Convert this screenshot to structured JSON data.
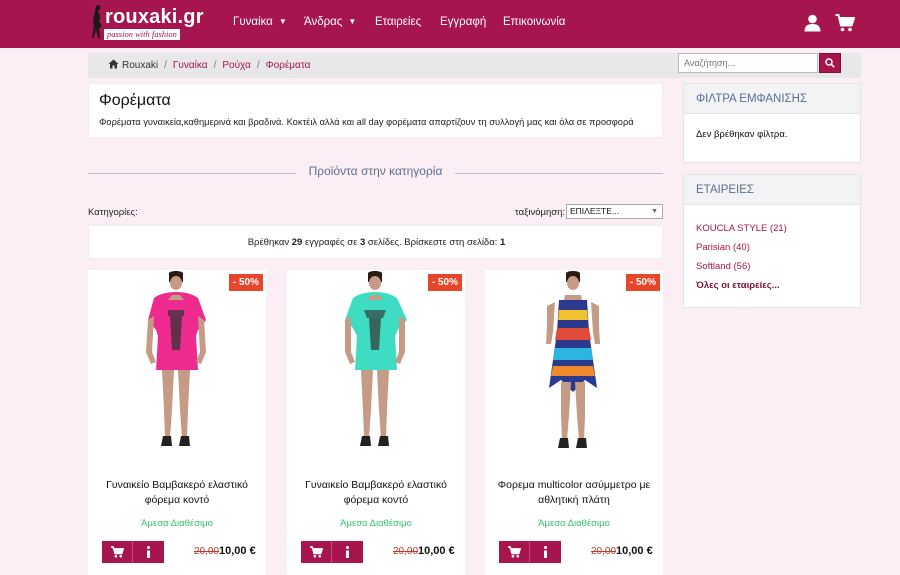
{
  "navbar": {
    "brand": "rouxaki.gr",
    "tagline": "passion with fashion",
    "items": [
      {
        "label": "Γυναίκα",
        "dropdown": true
      },
      {
        "label": "Άνδρας",
        "dropdown": true
      },
      {
        "label": "Εταιρείες",
        "dropdown": false
      },
      {
        "label": "Εγγραφή",
        "dropdown": false
      },
      {
        "label": "Επικοινωνία",
        "dropdown": false
      }
    ],
    "icons": [
      "user-icon",
      "cart-icon"
    ]
  },
  "breadcrumb": {
    "home": "Rouxaki",
    "items": [
      "Γυναίκα",
      "Ρούχα",
      "Φορέματα"
    ]
  },
  "search": {
    "placeholder": "Αναζήτηση..."
  },
  "category": {
    "title": "Φορέματα",
    "description": "Φορέματα γυναικεία,καθημερινά και βραδινά. Κοκτέιλ αλλά και all day φορέματα απαρτίζουν τη συλλογή μας και όλα σε προσφορά"
  },
  "section_title": "Προϊόντα στην κατηγορία",
  "filters": {
    "categories_label": "Κατηγορίες:",
    "sort_label": "ταξινόμηση:",
    "sort_value": "ΕΠΙΛΕΞΤΕ..."
  },
  "results": {
    "prefix": "Βρέθηκαν",
    "count": "29",
    "middle": "εγγραφές σε",
    "pages": "3",
    "suffix": "σελίδες. Βρίσκεστε στη σελίδα:",
    "current": "1"
  },
  "products": [
    {
      "name": "Γυναικείο Βαμβακερό ελαστικό φόρεμα κοντό",
      "badge": "- 50%",
      "availability": "Άμεσα Διαθέσιμο",
      "old_price": "20,00",
      "price": "10,00 €",
      "color": "#ee2a8f"
    },
    {
      "name": "Γυναικείο Βαμβακερό ελαστικό φόρεμα κοντό",
      "badge": "- 50%",
      "availability": "Άμεσα Διαθέσιμο",
      "old_price": "20,00",
      "price": "10,00 €",
      "color": "#3fdcc4"
    },
    {
      "name": "Φορεμα multicolor ασύμμετρο με αθλητική πλάτη",
      "badge": "- 50%",
      "availability": "Άμεσα Διαθέσιμο",
      "old_price": "20,00",
      "price": "10,00 €",
      "color": "multicolor"
    }
  ],
  "sidebar": {
    "filters_title": "ΦΙΛΤΡΑ ΕΜΦΑΝΙΣΗΣ",
    "filters_empty": "Δεν βρέθηκαν φίλτρα.",
    "brands_title": "ΕΤΑΙΡΕΙΕΣ",
    "brands": [
      "KOUCLA STYLE (21)",
      "Parisian (40)",
      "Softland (56)"
    ],
    "brands_all": "Όλες οι εταιρείες..."
  },
  "colors": {
    "brand": "#a6154d",
    "background": "#fbeef5",
    "available": "#35c36e",
    "discount": "#e8462b"
  }
}
